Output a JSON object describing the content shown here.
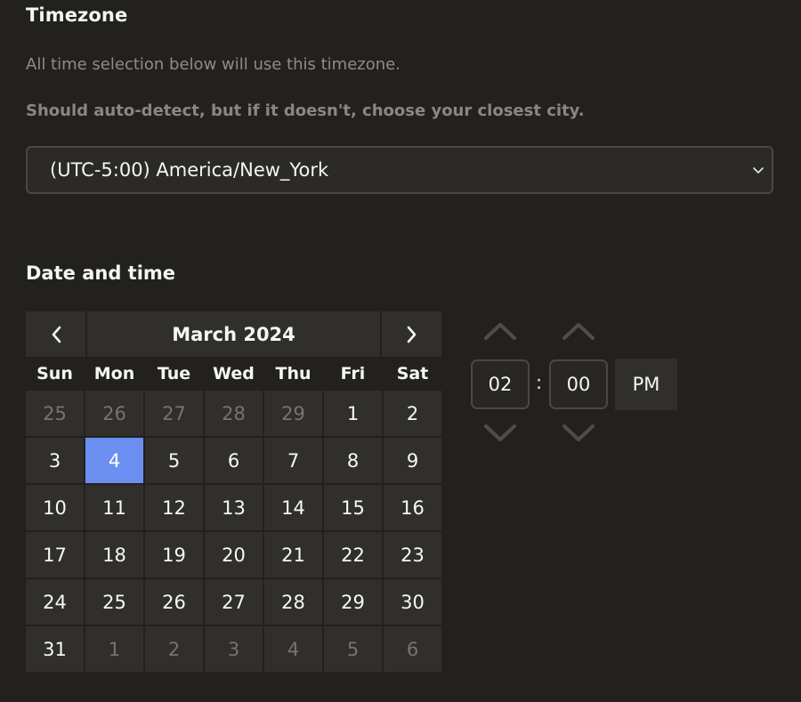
{
  "timezone": {
    "title": "Timezone",
    "subtitle": "All time selection below will use this timezone.",
    "hint": "Should auto-detect, but if it doesn't, choose your closest city.",
    "selected": "(UTC-5:00) America/New_York"
  },
  "datetime": {
    "title": "Date and time"
  },
  "calendar": {
    "month_label": "March 2024",
    "weekdays": [
      "Sun",
      "Mon",
      "Tue",
      "Wed",
      "Thu",
      "Fri",
      "Sat"
    ],
    "days": [
      {
        "label": "25",
        "muted": true
      },
      {
        "label": "26",
        "muted": true
      },
      {
        "label": "27",
        "muted": true
      },
      {
        "label": "28",
        "muted": true
      },
      {
        "label": "29",
        "muted": true
      },
      {
        "label": "1"
      },
      {
        "label": "2"
      },
      {
        "label": "3"
      },
      {
        "label": "4",
        "selected": true
      },
      {
        "label": "5"
      },
      {
        "label": "6"
      },
      {
        "label": "7"
      },
      {
        "label": "8"
      },
      {
        "label": "9"
      },
      {
        "label": "10"
      },
      {
        "label": "11"
      },
      {
        "label": "12"
      },
      {
        "label": "13"
      },
      {
        "label": "14"
      },
      {
        "label": "15"
      },
      {
        "label": "16"
      },
      {
        "label": "17"
      },
      {
        "label": "18"
      },
      {
        "label": "19"
      },
      {
        "label": "20"
      },
      {
        "label": "21"
      },
      {
        "label": "22"
      },
      {
        "label": "23"
      },
      {
        "label": "24"
      },
      {
        "label": "25"
      },
      {
        "label": "26"
      },
      {
        "label": "27"
      },
      {
        "label": "28"
      },
      {
        "label": "29"
      },
      {
        "label": "30"
      },
      {
        "label": "31"
      },
      {
        "label": "1",
        "muted": true
      },
      {
        "label": "2",
        "muted": true
      },
      {
        "label": "3",
        "muted": true
      },
      {
        "label": "4",
        "muted": true
      },
      {
        "label": "5",
        "muted": true
      },
      {
        "label": "6",
        "muted": true
      }
    ]
  },
  "time": {
    "hour": "02",
    "separator": ":",
    "minute": "00",
    "period": "PM"
  },
  "colors": {
    "background": "#22211e",
    "cell": "#302f2c",
    "selected": "#6b8ff0",
    "muted_text": "#77746f"
  },
  "icons": {
    "dropdown": "chevron-down-icon",
    "prev": "chevron-left-icon",
    "next": "chevron-right-icon",
    "increment": "chevron-up-icon",
    "decrement": "chevron-down-icon"
  }
}
